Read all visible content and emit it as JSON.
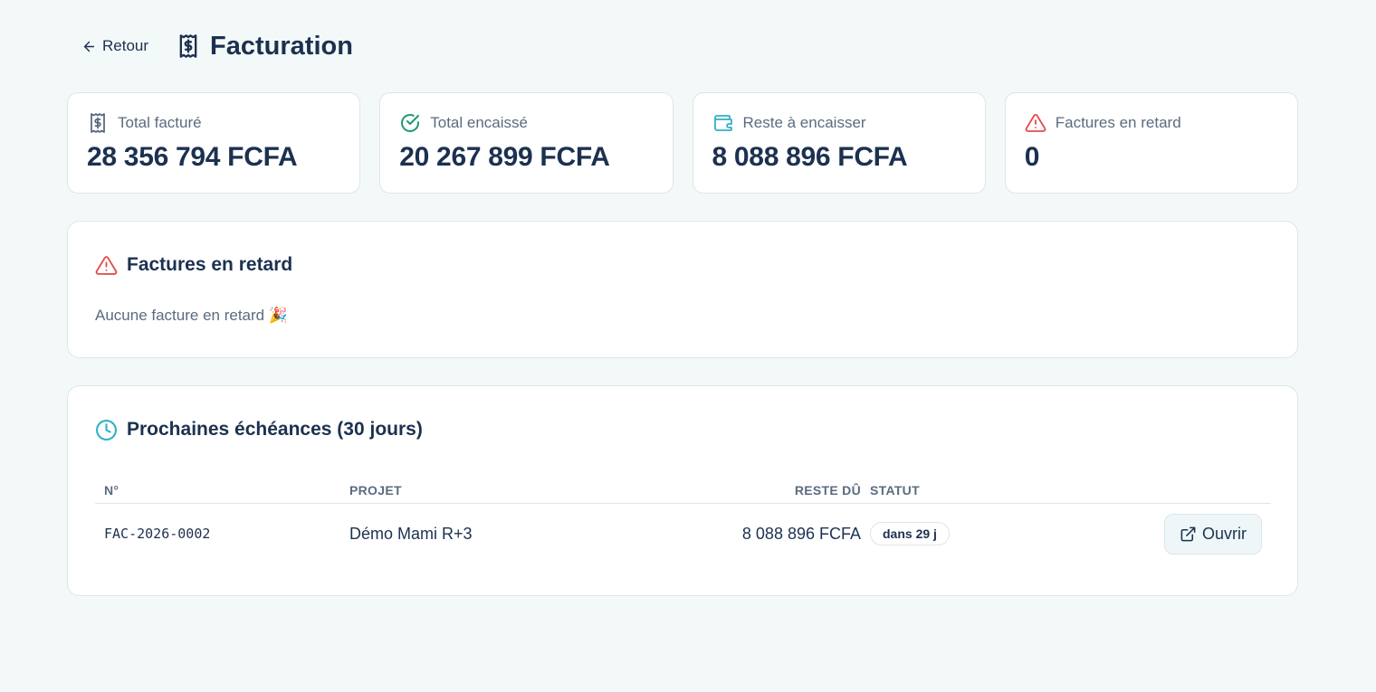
{
  "header": {
    "back_label": "Retour",
    "title": "Facturation"
  },
  "stats": [
    {
      "icon": "receipt-dollar-icon",
      "label": "Total facturé",
      "value": "28 356 794 FCFA"
    },
    {
      "icon": "check-circle-icon",
      "label": "Total encaissé",
      "value": "20 267 899 FCFA"
    },
    {
      "icon": "wallet-icon",
      "label": "Reste à encaisser",
      "value": "8 088 896 FCFA"
    },
    {
      "icon": "warning-triangle-icon",
      "label": "Factures en retard",
      "value": "0"
    }
  ],
  "late_panel": {
    "title": "Factures en retard",
    "empty_text": "Aucune facture en retard 🎉"
  },
  "upcoming_panel": {
    "title": "Prochaines échéances (30 jours)",
    "columns": [
      "N°",
      "PROJET",
      "RESTE DÛ",
      "STATUT"
    ],
    "rows": [
      {
        "number": "FAC-2026-0002",
        "project": "Démo Mami R+3",
        "remaining": "8 088 896 FCFA",
        "status": "dans 29 j",
        "action": "Ouvrir"
      }
    ]
  },
  "colors": {
    "background": "#f3f9f9",
    "text_primary": "#1c3150",
    "text_muted": "#5b6b80",
    "success": "#1f9a6e",
    "info": "#2fb0c6",
    "danger": "#e24c4b"
  }
}
